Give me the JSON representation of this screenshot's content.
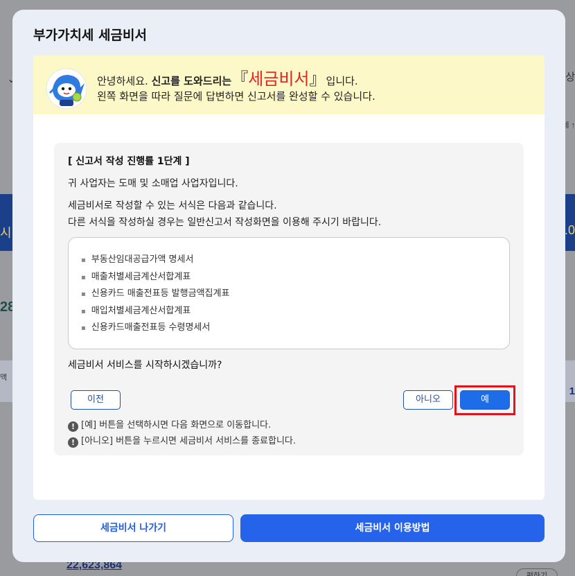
{
  "background": {
    "left_band_text": "시",
    "left_number": "28",
    "left_small": "액",
    "right_tab_text": "상",
    "right_small": "세 ↑",
    "right_band_text": ".0",
    "right_number": "1",
    "bottom_amount": "22,623,864",
    "bottom_button": "편하기"
  },
  "modal": {
    "title": "부가가치세 세금비서",
    "banner": {
      "greeting": "안녕하세요.",
      "help_bold": "신고를 도와드리는",
      "bracket_open": "『",
      "brand": "세금비서",
      "bracket_close": "』",
      "suffix": "입니다.",
      "line2": "왼쪽 화면을 따라 질문에 답변하면 신고서를 완성할 수 있습니다."
    },
    "step": {
      "title": "[ 신고서 작성 진행률 1단계 ]",
      "business_type": "귀 사업자는 도매 및 소매업 사업자입니다.",
      "forms_intro": "세금비서로 작성할 수 있는 서식은 다음과 같습니다.",
      "other_forms": "다른 서식을 작성하실 경우는 일반신고서 작성화면을 이용해 주시기 바랍니다.",
      "forms": [
        "부동산임대공급가액 명세서",
        "매출처별세금계산서합계표",
        "신용카드 매출전표등 발행금액집계표",
        "매입처별세금계산서합계표",
        "신용카드매출전표등 수령명세서"
      ],
      "question": "세금비서 서비스를 시작하시겠습니까?",
      "prev_label": "이전",
      "no_label": "아니오",
      "yes_label": "예",
      "notice_yes": "[예] 버튼을 선택하시면 다음 화면으로 이동합니다.",
      "notice_no": "[아니오] 버튼을 누르시면 세금비서 서비스를 종료합니다."
    },
    "footer": {
      "exit_label": "세금비서 나가기",
      "guide_label": "세금비서 이용방법"
    }
  },
  "colors": {
    "brand_red": "#e02525",
    "primary_blue": "#2563eb",
    "banner_yellow": "#fdf8c8",
    "highlight_red": "#e0121b"
  },
  "icons": {
    "mascot": "tax-secretary-mascot-icon",
    "notice": "exclamation-circle-icon"
  }
}
